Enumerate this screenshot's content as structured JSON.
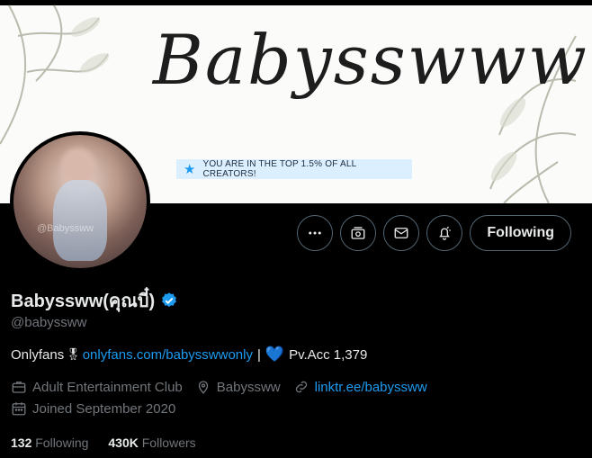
{
  "banner": {
    "script_text": "Babysswww",
    "ribbon_text": "YOU ARE IN THE TOP 1.5% OF ALL CREATORS!",
    "ribbon_icon": "star-icon",
    "avatar_watermark": "@Babyssww"
  },
  "actions": {
    "more_icon": "more-icon",
    "subscriptions_icon": "subscriptions-icon",
    "message_icon": "message-icon",
    "notifications_icon": "notifications-icon",
    "follow_label": "Following"
  },
  "profile": {
    "name": "Babyssww(คุณบี๋)",
    "handle": "@babyssww",
    "bio": {
      "prefix": "Onlyfans",
      "medal": "🎖",
      "link": "onlyfans.com/babysswwonly",
      "separator": "|",
      "heart": "💙",
      "suffix": "Pv.Acc 1,379"
    },
    "category": "Adult Entertainment Club",
    "location": "Babyssww",
    "website": "linktr.ee/babyssww",
    "joined": "Joined September 2020"
  },
  "stats": {
    "following_count": "132",
    "following_label": "Following",
    "followers_count": "430K",
    "followers_label": "Followers"
  },
  "colors": {
    "accent": "#1d9bf0",
    "background": "#000000",
    "muted": "#71767b",
    "text": "#e7e9ea"
  }
}
